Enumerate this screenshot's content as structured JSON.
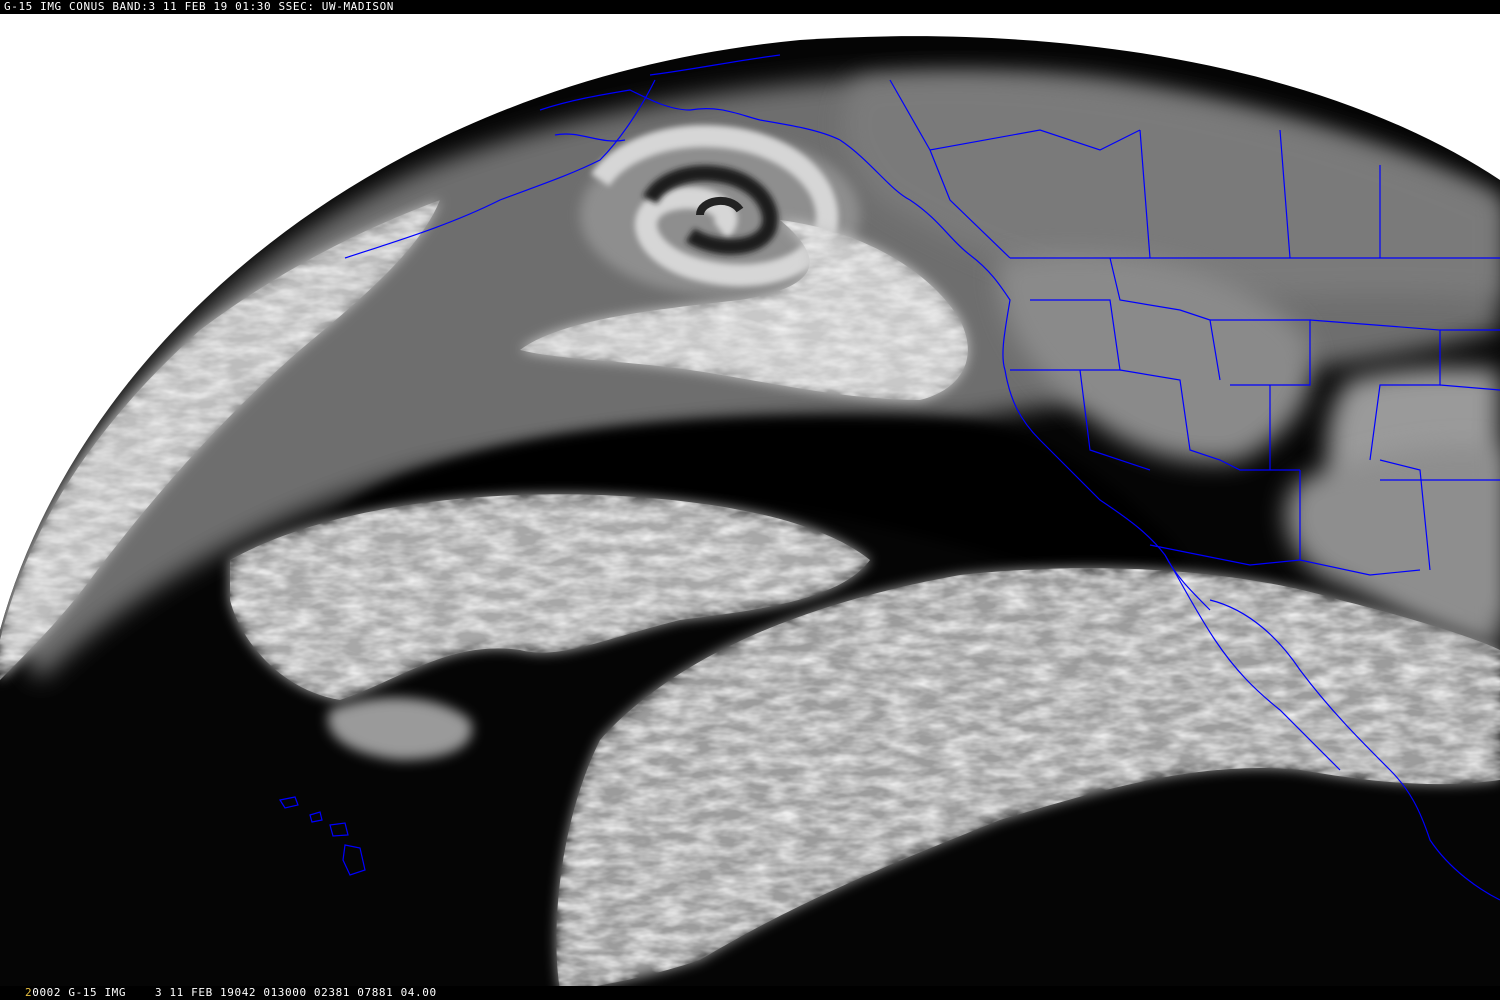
{
  "header": {
    "text": "G-15 IMG CONUS BAND:3 11 FEB 19 01:30 SSEC: UW-MADISON"
  },
  "footer": {
    "lead_char": "2",
    "text": "0002 G-15 IMG    3 11 FEB 19042 013000 02381 07881 04.00"
  },
  "image": {
    "space_color": "#ffffff",
    "background_color": "#000000",
    "boundary_color": "#0000ff",
    "subject": "water-vapor"
  }
}
